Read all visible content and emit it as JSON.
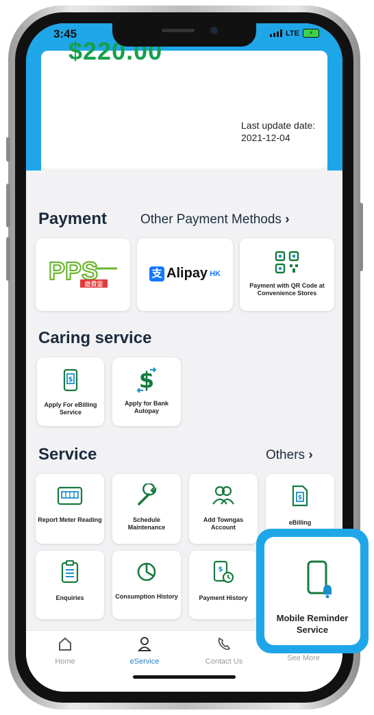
{
  "status": {
    "time": "3:45",
    "network": "LTE"
  },
  "balance": {
    "amount": "$220.00",
    "update_label": "Last update date:",
    "update_date": "2021-12-04"
  },
  "payment": {
    "title": "Payment",
    "link": "Other Payment Methods",
    "methods": [
      {
        "label": "PPS",
        "sub": "繳費靈"
      },
      {
        "label": "Alipay",
        "suffix": "HK"
      },
      {
        "label": "Payment with QR Code at Convenience Stores"
      }
    ]
  },
  "caring": {
    "title": "Caring service",
    "items": [
      {
        "label": "Apply For eBilling Service"
      },
      {
        "label": "Apply for Bank Autopay"
      }
    ]
  },
  "service": {
    "title": "Service",
    "link": "Others",
    "items": [
      {
        "label": "Report Meter Reading"
      },
      {
        "label": "Schedule Maintenance"
      },
      {
        "label": "Add Towngas Account"
      },
      {
        "label": "eBilling"
      },
      {
        "label": "Enquiries"
      },
      {
        "label": "Consumption History"
      },
      {
        "label": "Payment History"
      },
      {
        "label": "Mobile Reminder Service"
      }
    ]
  },
  "tabs": [
    {
      "label": "Home"
    },
    {
      "label": "eService"
    },
    {
      "label": "Contact Us"
    },
    {
      "label": "See More"
    }
  ],
  "colors": {
    "accent": "#1fa6e8",
    "amount": "#16a04a",
    "active_tab": "#2a7fc7"
  }
}
